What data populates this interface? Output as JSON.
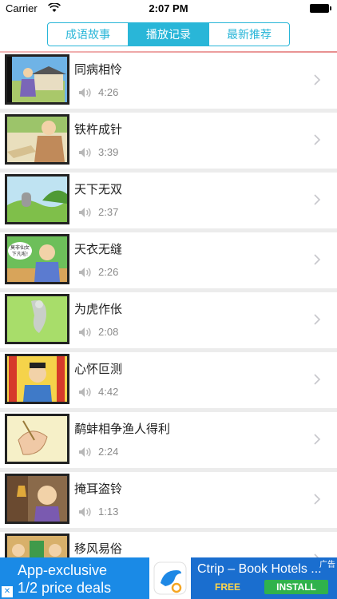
{
  "status_bar": {
    "carrier": "Carrier",
    "time": "2:07 PM"
  },
  "tabs": [
    {
      "label": "成语故事",
      "active": false
    },
    {
      "label": "播放记录",
      "active": true
    },
    {
      "label": "最新推荐",
      "active": false
    }
  ],
  "list": [
    {
      "title": "同病相怜",
      "duration": "4:26"
    },
    {
      "title": "铁杵成针",
      "duration": "3:39"
    },
    {
      "title": "天下无双",
      "duration": "2:37"
    },
    {
      "title": "天衣无缝",
      "duration": "2:26"
    },
    {
      "title": "为虎作伥",
      "duration": "2:08"
    },
    {
      "title": "心怀叵测",
      "duration": "4:42"
    },
    {
      "title": "鹬蚌相争渔人得利",
      "duration": "2:24"
    },
    {
      "title": "掩耳盗铃",
      "duration": "1:13"
    },
    {
      "title": "移风易俗",
      "duration": ""
    }
  ],
  "thumb_texts": {
    "row4_bubble": "莫非仙女下凡啦!"
  },
  "ad": {
    "line1": "App-exclusive",
    "line2": "1/2 price deals",
    "app_name": "Ctrip – Book Hotels ...",
    "free_label": "FREE",
    "install_label": "INSTALL",
    "ad_tag": "广告"
  },
  "colors": {
    "accent": "#29b6d8",
    "ad_blue": "#1a8ae6",
    "install_green": "#2fb24c"
  }
}
